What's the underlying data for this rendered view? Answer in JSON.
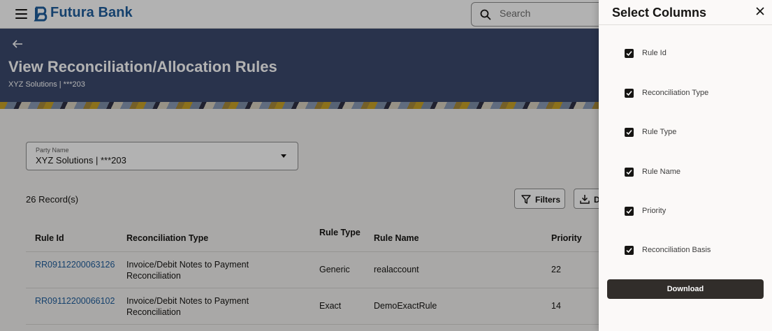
{
  "header": {
    "brand": "Futura Bank",
    "search_placeholder": "Search"
  },
  "banner": {
    "title": "View Reconciliation/Allocation Rules",
    "subtitle": "XYZ Solutions | ***203"
  },
  "party_filter": {
    "label": "Party Name",
    "value": "XYZ Solutions | ***203"
  },
  "records": {
    "count_text": "26 Record(s)"
  },
  "toolbar": {
    "filters_label": "Filters",
    "download_label": "D"
  },
  "table": {
    "columns": [
      "Rule Id",
      "Reconciliation Type",
      "Rule Type",
      "Rule Name",
      "Priority"
    ],
    "rows": [
      {
        "rule_id": "RR09112200063126",
        "reconciliation_type": "Invoice/Debit Notes to Payment Reconciliation",
        "rule_type": "Generic",
        "rule_name": "realaccount",
        "priority": "22"
      },
      {
        "rule_id": "RR09112200066102",
        "reconciliation_type": "Invoice/Debit Notes to Payment Reconciliation",
        "rule_type": "Exact",
        "rule_name": "DemoExactRule",
        "priority": "14"
      }
    ]
  },
  "panel": {
    "title": "Select Columns",
    "options": [
      {
        "label": "Rule Id",
        "checked": true
      },
      {
        "label": "Reconciliation Type",
        "checked": true
      },
      {
        "label": "Rule Type",
        "checked": true
      },
      {
        "label": "Rule Name",
        "checked": true
      },
      {
        "label": "Priority",
        "checked": true
      },
      {
        "label": "Reconciliation Basis",
        "checked": true
      }
    ],
    "download_label": "Download"
  },
  "colors": {
    "brand": "#1f5d9c",
    "banner": "#3c4a6e",
    "primary_button": "#312d2a"
  }
}
